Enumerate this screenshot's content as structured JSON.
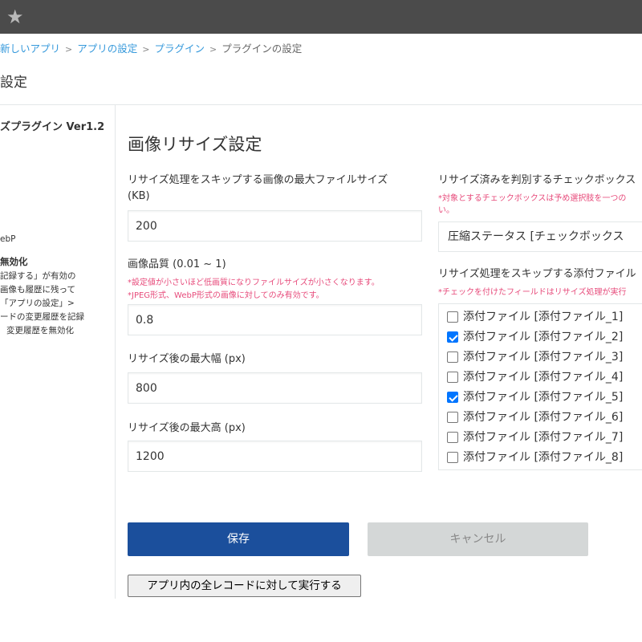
{
  "topbar": {
    "icon": "star-icon"
  },
  "breadcrumb": {
    "items": [
      "新しいアプリ",
      "アプリの設定",
      "プラグイン"
    ],
    "separator": ">",
    "current": "プラグインの設定"
  },
  "page_title": "設定",
  "sidebar": {
    "plugin_name": "ズプラグイン Ver1.2",
    "format_fragment": "ebP",
    "bold_heading": "無効化",
    "lines": [
      "記録する」が有効の",
      "画像も履歴に残って",
      "「アプリの設定」>",
      "ードの変更履歴を記録",
      "変更履歴を無効化"
    ]
  },
  "main": {
    "section_title": "画像リサイズ設定",
    "skip_size": {
      "label": "リサイズ処理をスキップする画像の最大ファイルサイズ (KB)",
      "value": "200"
    },
    "quality": {
      "label": "画像品質 (0.01 ~ 1)",
      "notes": [
        "*設定値が小さいほど低画質になりファイルサイズが小さくなります。",
        "*JPEG形式、WebP形式の画像に対してのみ有効です。"
      ],
      "value": "0.8"
    },
    "max_width": {
      "label": "リサイズ後の最大幅 (px)",
      "value": "800"
    },
    "max_height": {
      "label": "リサイズ後の最大高 (px)",
      "value": "1200"
    }
  },
  "right": {
    "status_checkbox": {
      "label": "リサイズ済みを判別するチェックボックス",
      "note_line1": "*対象とするチェックボックスは予め選択肢を一つの",
      "note_line2": "い。",
      "selected": "圧縮ステータス [チェックボックス"
    },
    "skip_attachments": {
      "label": "リサイズ処理をスキップする添付ファイル",
      "note": "*チェックを付けたフィールドはリサイズ処理が実行",
      "items": [
        {
          "label": "添付ファイル [添付ファイル_1]",
          "checked": false
        },
        {
          "label": "添付ファイル [添付ファイル_2]",
          "checked": true
        },
        {
          "label": "添付ファイル [添付ファイル_3]",
          "checked": false
        },
        {
          "label": "添付ファイル [添付ファイル_4]",
          "checked": false
        },
        {
          "label": "添付ファイル [添付ファイル_5]",
          "checked": true
        },
        {
          "label": "添付ファイル [添付ファイル_6]",
          "checked": false
        },
        {
          "label": "添付ファイル [添付ファイル_7]",
          "checked": false
        },
        {
          "label": "添付ファイル [添付ファイル_8]",
          "checked": false
        }
      ]
    }
  },
  "buttons": {
    "save": "保存",
    "cancel": "キャンセル",
    "run_all": "アプリ内の全レコードに対して実行する"
  },
  "colors": {
    "topbar": "#4b4b4b",
    "link": "#3498db",
    "note": "#e74b7b",
    "save_button": "#1b4f9c",
    "cancel_button": "#d4d7d7",
    "checkbox_checked": "#0075ff"
  }
}
